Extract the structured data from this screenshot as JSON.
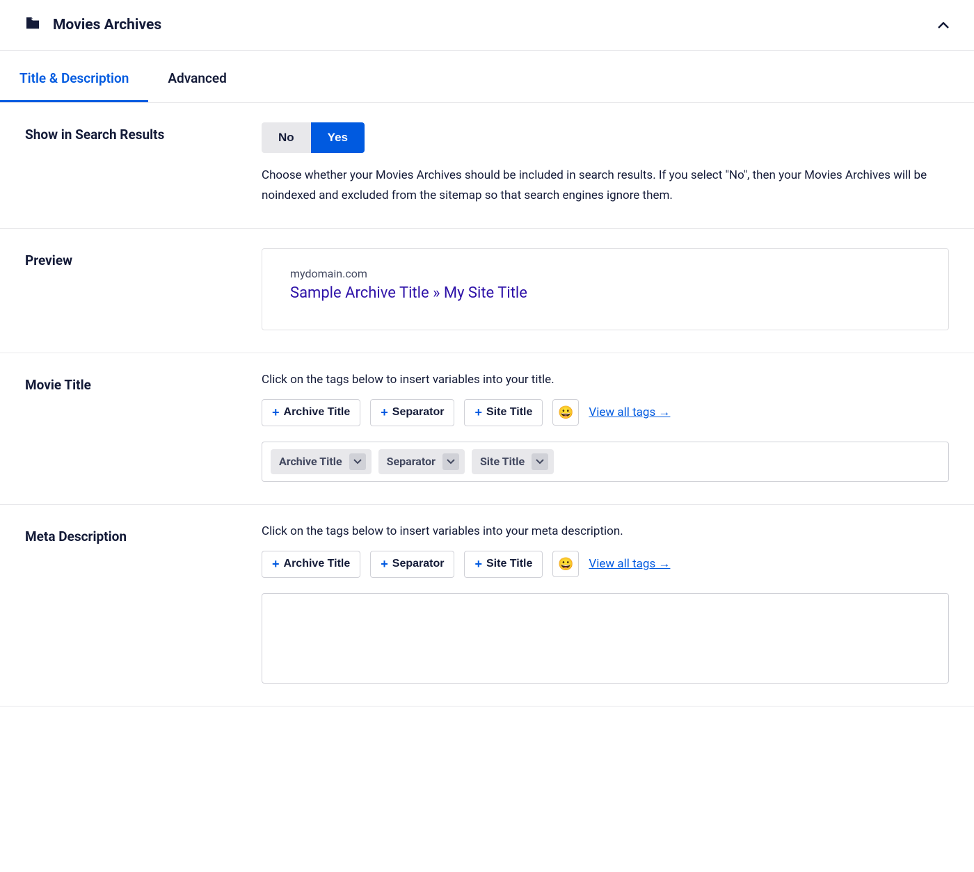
{
  "header": {
    "title": "Movies Archives"
  },
  "tabs": [
    {
      "label": "Title & Description",
      "active": true
    },
    {
      "label": "Advanced",
      "active": false
    }
  ],
  "sections": {
    "show_in_search": {
      "label": "Show in Search Results",
      "no": "No",
      "yes": "Yes",
      "selected": "Yes",
      "help": "Choose whether your Movies Archives should be included in search results. If you select \"No\", then your Movies Archives will be noindexed and excluded from the sitemap so that search engines ignore them."
    },
    "preview": {
      "label": "Preview",
      "domain": "mydomain.com",
      "title": "Sample Archive Title » My Site Title"
    },
    "movie_title": {
      "label": "Movie Title",
      "instruction": "Click on the tags below to insert variables into your title.",
      "tags": [
        "Archive Title",
        "Separator",
        "Site Title"
      ],
      "view_all": "View all tags →",
      "chips": [
        "Archive Title",
        "Separator",
        "Site Title"
      ]
    },
    "meta_description": {
      "label": "Meta Description",
      "instruction": "Click on the tags below to insert variables into your meta description.",
      "tags": [
        "Archive Title",
        "Separator",
        "Site Title"
      ],
      "view_all": "View all tags →"
    }
  }
}
